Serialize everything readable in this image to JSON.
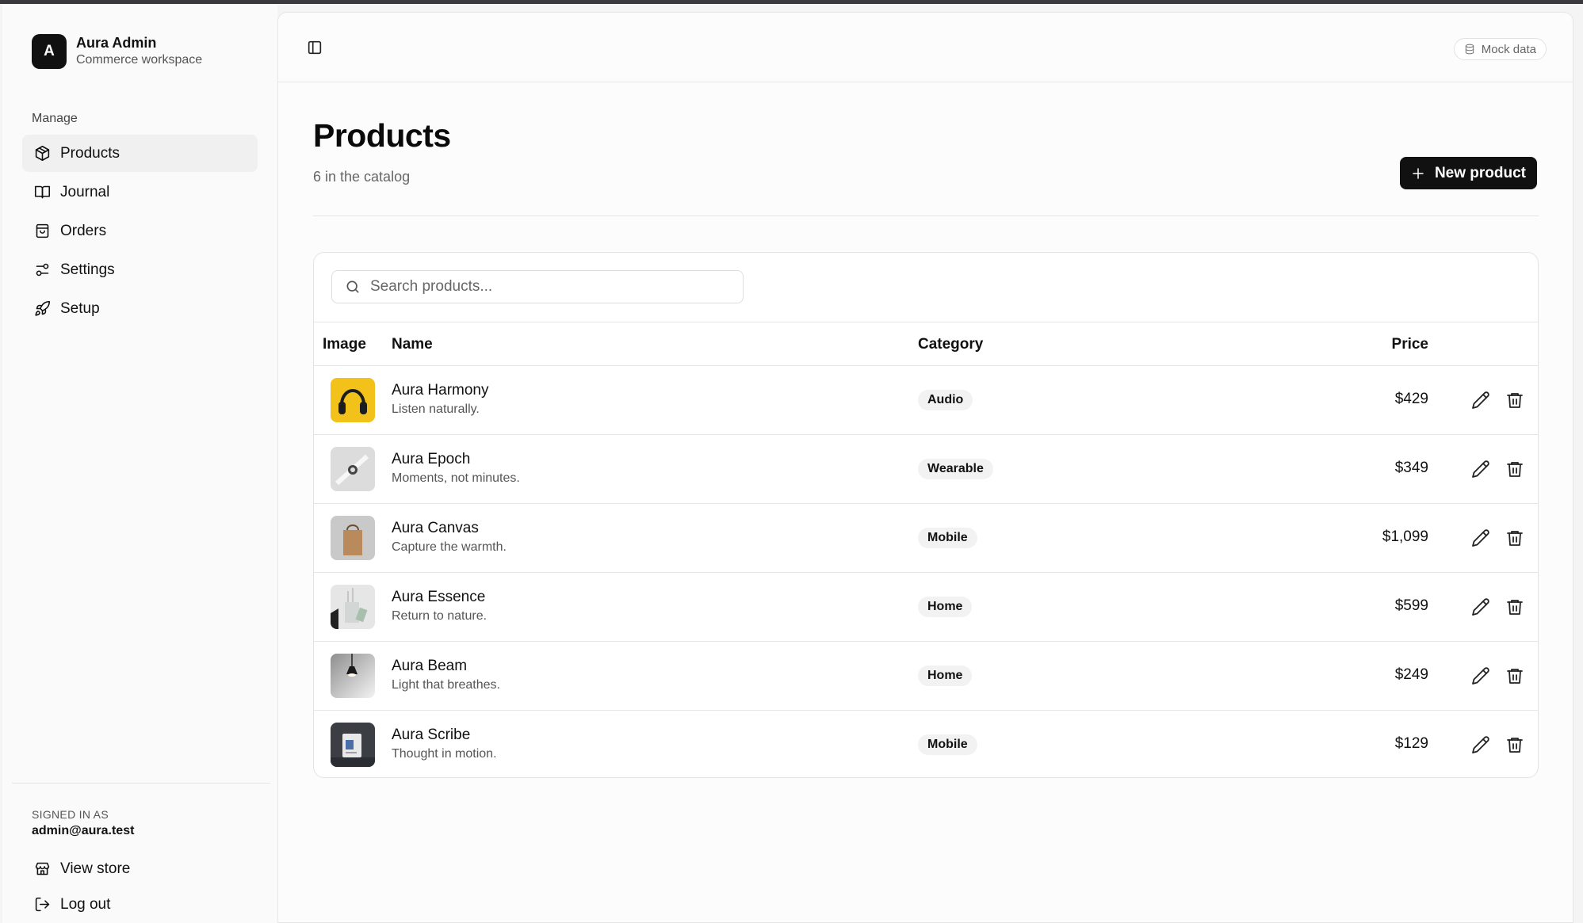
{
  "brand": {
    "logo_letter": "A",
    "title": "Aura Admin",
    "subtitle": "Commerce workspace"
  },
  "sidebar": {
    "section_label": "Manage",
    "items": [
      {
        "label": "Products",
        "icon": "package-icon",
        "active": true
      },
      {
        "label": "Journal",
        "icon": "book-icon"
      },
      {
        "label": "Orders",
        "icon": "shopping-bag-icon"
      },
      {
        "label": "Settings",
        "icon": "sliders-icon"
      },
      {
        "label": "Setup",
        "icon": "rocket-icon"
      }
    ],
    "signed_in_label": "SIGNED IN AS",
    "signed_in_email": "admin@aura.test",
    "footer_items": [
      {
        "label": "View store",
        "icon": "store-icon"
      },
      {
        "label": "Log out",
        "icon": "log-out-icon"
      }
    ]
  },
  "header": {
    "mock_label": "Mock data"
  },
  "page": {
    "title": "Products",
    "subtitle": "6 in the catalog",
    "new_button": "New product"
  },
  "search": {
    "placeholder": "Search products..."
  },
  "table": {
    "columns": {
      "image": "Image",
      "name": "Name",
      "category": "Category",
      "price": "Price"
    },
    "rows": [
      {
        "name": "Aura Harmony",
        "tagline": "Listen naturally.",
        "category": "Audio",
        "price": "$429",
        "thumb": "yellow-headphones"
      },
      {
        "name": "Aura Epoch",
        "tagline": "Moments, not minutes.",
        "category": "Wearable",
        "price": "$349",
        "thumb": "white-watch"
      },
      {
        "name": "Aura Canvas",
        "tagline": "Capture the warmth.",
        "category": "Mobile",
        "price": "$1,099",
        "thumb": "paper-bag"
      },
      {
        "name": "Aura Essence",
        "tagline": "Return to nature.",
        "category": "Home",
        "price": "$599",
        "thumb": "glass-diffuser"
      },
      {
        "name": "Aura Beam",
        "tagline": "Light that breathes.",
        "category": "Home",
        "price": "$249",
        "thumb": "pendant-lamp"
      },
      {
        "name": "Aura Scribe",
        "tagline": "Thought in motion.",
        "category": "Mobile",
        "price": "$129",
        "thumb": "tablet-desk"
      }
    ]
  }
}
